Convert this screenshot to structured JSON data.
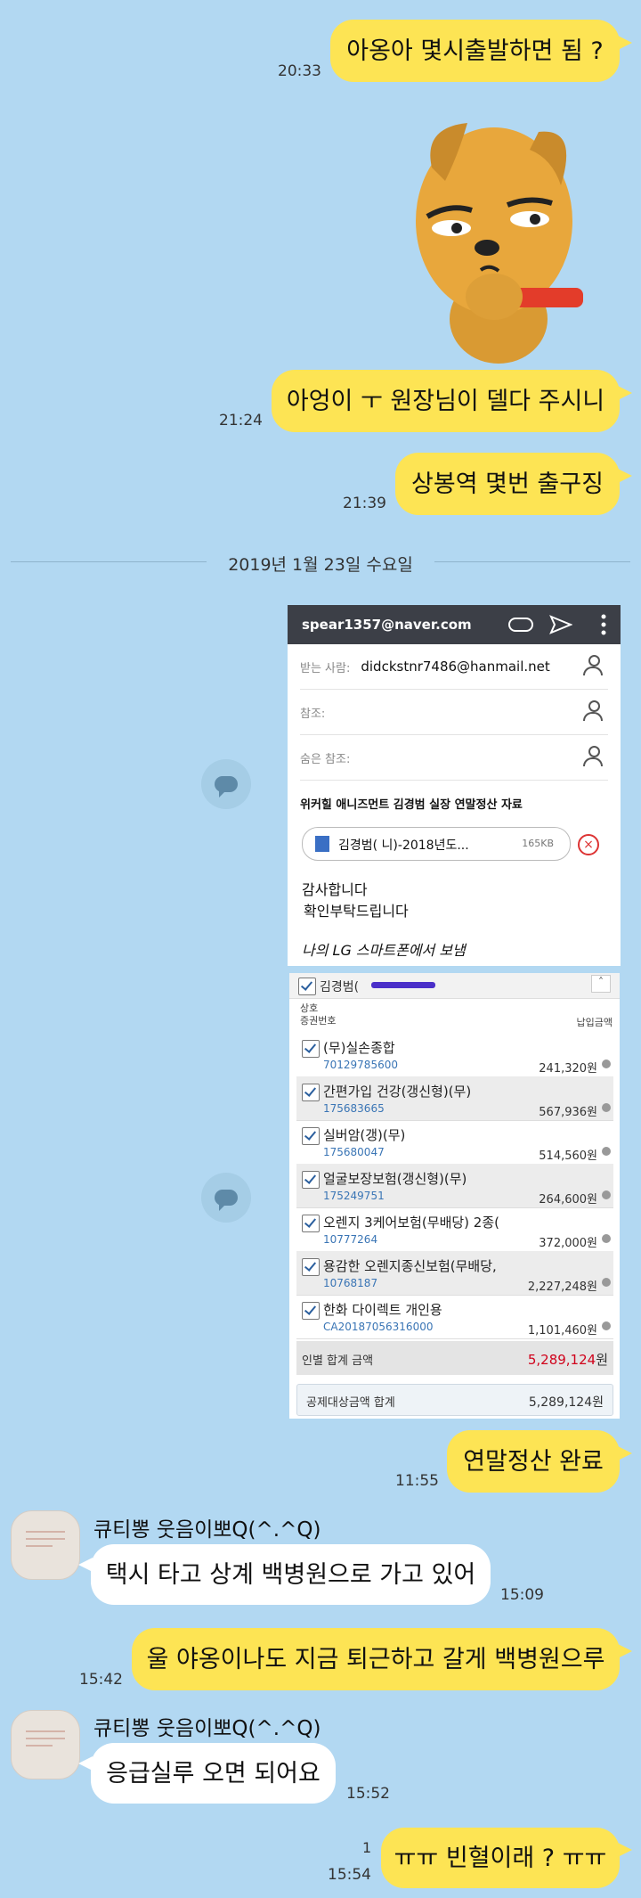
{
  "messages": [
    {
      "text": "아옹아 몇시출발하면 됨 ?",
      "time": "20:33"
    },
    {
      "text": "아엉이 ㅜ 원장님이 델다 주시니",
      "time": "21:24"
    },
    {
      "text": "상봉역 몇번 출구징",
      "time": "21:39"
    },
    {
      "text": "연말정산 완료",
      "time": "11:55"
    },
    {
      "text": "택시 타고 상계 백병원으로 가고 있어",
      "time": "15:09"
    },
    {
      "text": "울 야옹이나도 지금 퇴근하고 갈게 백병원으루",
      "time": "15:42"
    },
    {
      "text": "응급실루 오면 되어요",
      "time": "15:52"
    },
    {
      "text": "ㅠㅠ 빈혈이래 ? ㅠㅠ",
      "time": "15:54",
      "unread": "1"
    }
  ],
  "date_divider": "2019년 1월 23일 수요일",
  "sender_name": "큐티뽕 웃음이뽀Q(^.^Q)",
  "email": {
    "from": "spear1357@naver.com",
    "to_label": "받는 사람:",
    "to": "didckstnr7486@hanmail.net",
    "cc_label": "참조:",
    "bcc_label": "숨은 참조:",
    "subject": "위커힐 애니즈먼트 김경범 실장 연말정산 자료",
    "attachment": "김경범(      니)-2018년도...",
    "attachment_size": "165KB",
    "body1": "감사합니다",
    "body2": "확인부탁드립니다",
    "signature": "나의 LG 스마트폰에서 보냄"
  },
  "insurance": {
    "person": "김경범(",
    "col_left1": "상호",
    "col_left2": "증권번호",
    "col_right": "납입금액",
    "rows": [
      {
        "name": "(무)실손종합",
        "num": "70129785600",
        "amt": "241,320원"
      },
      {
        "name": "간편가입 건강(갱신형)(무)",
        "num": "175683665",
        "amt": "567,936원"
      },
      {
        "name": "실버암(갱)(무)",
        "num": "175680047",
        "amt": "514,560원"
      },
      {
        "name": "얼굴보장보험(갱신형)(무)",
        "num": "175249751",
        "amt": "264,600원"
      },
      {
        "name": "오렌지 3케어보험(무배당) 2종(",
        "num": "10777264",
        "amt": "372,000원"
      },
      {
        "name": "용감한 오렌지종신보험(무배당,",
        "num": "10768187",
        "amt": "2,227,248원"
      },
      {
        "name": "한화 다이렉트 개인용",
        "num": "CA20187056316000",
        "amt": "1,101,460원"
      }
    ],
    "total_label": "인별 합계 금액",
    "total": "5,289,124",
    "total_unit": "원",
    "deduct_label": "공제대상금액 합계",
    "deduct": "5,289,124원"
  },
  "colors": {
    "background": "#b2d8f2",
    "my_bubble": "#fde454",
    "their_bubble": "#ffffff",
    "total_red": "#d0021b"
  }
}
